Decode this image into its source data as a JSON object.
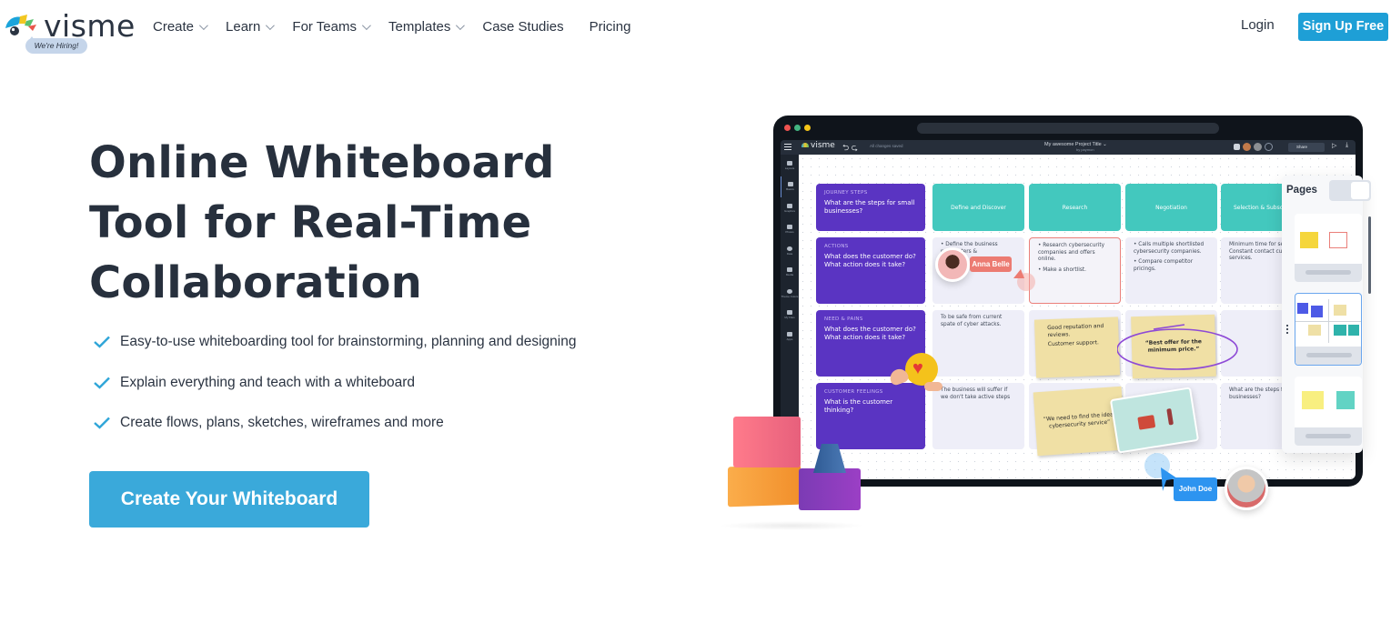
{
  "nav": {
    "logo_text": "visme",
    "hiring_badge": "We're Hiring!",
    "menu": [
      {
        "label": "Create",
        "has_dropdown": true
      },
      {
        "label": "Learn",
        "has_dropdown": true
      },
      {
        "label": "For Teams",
        "has_dropdown": true
      },
      {
        "label": "Templates",
        "has_dropdown": true
      },
      {
        "label": "Case Studies",
        "has_dropdown": false
      },
      {
        "label": "Pricing",
        "has_dropdown": false
      }
    ],
    "login_label": "Login",
    "signup_label": "Sign Up Free"
  },
  "hero": {
    "title_lines": [
      "Online Whiteboard",
      "Tool for Real-Time",
      "Collaboration"
    ],
    "features": [
      "Easy-to-use whiteboarding tool for brainstorming, planning and designing",
      "Explain everything and teach with a whiteboard",
      "Create flows, plans, sketches, wireframes and more"
    ],
    "cta_label": "Create Your Whiteboard"
  },
  "mockup": {
    "app_logo": "visme",
    "undo_redo": "⮌ ⮎",
    "saved_status": "All changes saved",
    "project_title": "My awesome Project Title ⌄",
    "project_by": "by paymon",
    "share_label": "Share",
    "sidebar": [
      "Layouts",
      "Basics",
      "Graphics",
      "Photos",
      "Data",
      "Media",
      "Theme Colors",
      "My Files",
      "Apps"
    ],
    "rows": [
      {
        "caption": "JOURNEY STEPS",
        "question": "What are the steps for small businesses?"
      },
      {
        "caption": "ACTIONS",
        "question": "What does the customer do? What action does it take?"
      },
      {
        "caption": "NEED & PAINS",
        "question": "What does the customer do? What action does it take?"
      },
      {
        "caption": "CUSTOMER FEELINGS",
        "question": "What is the customer thinking?"
      }
    ],
    "stages": [
      "Define and Discover",
      "Research",
      "Negotiation",
      "Selection & Subscription"
    ],
    "cells": {
      "actions_define": [
        "Define the business parameters &",
        "..."
      ],
      "actions_research": [
        "Research cybersecurity companies and offers online.",
        "Make a shortlist."
      ],
      "actions_negotiation": [
        "Calls multiple shortlisted cybersecurity companies.",
        "Compare competitor pricings."
      ],
      "actions_selection": "Minimum time for setup. Constant contact customer services.",
      "needs_define": "To be safe from current spate of cyber attacks.",
      "needs_research": [
        "Good reputation and reviews.",
        "Customer support."
      ],
      "needs_negotiation": "“Best offer for the minimum price.”",
      "feelings_define": "The business will suffer if we don't take active steps",
      "feelings_research": "“We need to find the ideal cybersecurity service”",
      "feelings_selection": "What are the steps for small businesses?"
    },
    "collaborators": [
      {
        "name": "Anna Belle",
        "color": "#ec7b72"
      },
      {
        "name": "John Doe",
        "color": "#2d94f0"
      }
    ],
    "pages_panel": {
      "title": "Pages"
    }
  }
}
